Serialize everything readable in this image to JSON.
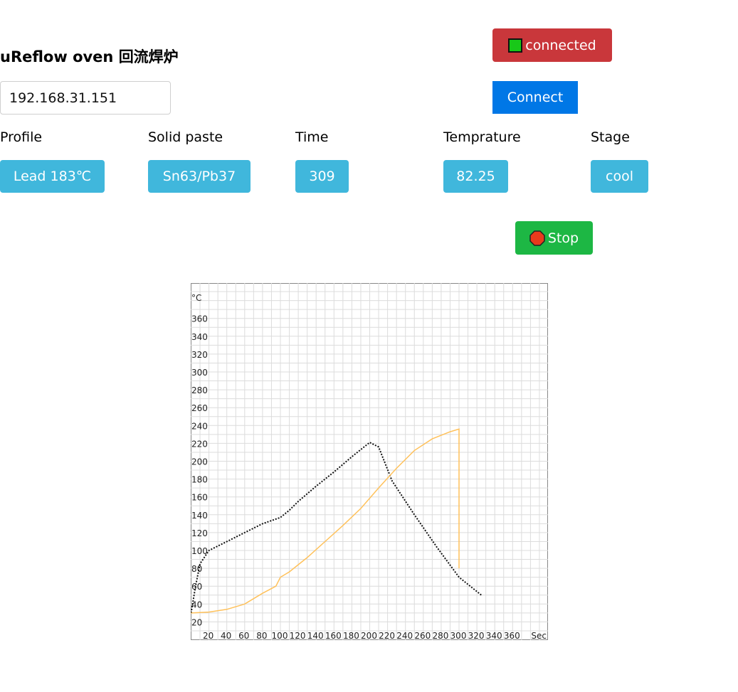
{
  "app": {
    "title": "uReflow oven 回流焊炉"
  },
  "status": {
    "label": "connected",
    "indicator_color": "#18c818"
  },
  "connection": {
    "ip_value": "192.168.31.151",
    "connect_label": "Connect"
  },
  "fields": {
    "profile": {
      "label": "Profile",
      "value": "Lead 183℃"
    },
    "paste": {
      "label": "Solid paste",
      "value": "Sn63/Pb37"
    },
    "time": {
      "label": "Time",
      "value": "309"
    },
    "temperature": {
      "label": "Temprature",
      "value": "82.25"
    },
    "stage": {
      "label": "Stage",
      "value": "cool"
    }
  },
  "actions": {
    "stop_label": "Stop"
  },
  "colors": {
    "status_bg": "#c9373b",
    "connect_bg": "#0077e6",
    "badge_bg": "#40b7dc",
    "stop_bg": "#1db744",
    "stop_icon": "#e83b1c",
    "actual_line": "#ffc15a",
    "profile_line": "#111111"
  },
  "chart_data": {
    "type": "line",
    "title": "",
    "xlabel": "Sec",
    "ylabel": "°C",
    "xlim": [
      0,
      400
    ],
    "ylim": [
      0,
      400
    ],
    "grid": true,
    "x_ticks": [
      20,
      40,
      60,
      80,
      100,
      120,
      140,
      160,
      180,
      200,
      220,
      240,
      260,
      280,
      300,
      320,
      340,
      360
    ],
    "y_ticks": [
      20,
      40,
      60,
      80,
      100,
      120,
      140,
      160,
      180,
      200,
      220,
      240,
      260,
      280,
      300,
      320,
      340,
      360
    ],
    "series": [
      {
        "style": "dotted",
        "color": "#111111",
        "x": [
          0,
          5,
          10,
          20,
          40,
          60,
          80,
          100,
          110,
          120,
          140,
          160,
          180,
          200,
          210,
          225,
          250,
          275,
          300,
          325
        ],
        "y": [
          30,
          60,
          85,
          100,
          110,
          120,
          130,
          137,
          145,
          155,
          172,
          188,
          205,
          221,
          216,
          178,
          140,
          104,
          70,
          50
        ]
      },
      {
        "style": "solid",
        "color": "#ffc15a",
        "x": [
          0,
          20,
          40,
          60,
          80,
          95,
          100,
          110,
          130,
          150,
          170,
          190,
          210,
          230,
          250,
          270,
          290,
          300,
          300,
          300
        ],
        "y": [
          30,
          31,
          34,
          40,
          52,
          60,
          70,
          76,
          92,
          110,
          128,
          147,
          170,
          192,
          212,
          225,
          233,
          236,
          130,
          80
        ]
      }
    ]
  }
}
